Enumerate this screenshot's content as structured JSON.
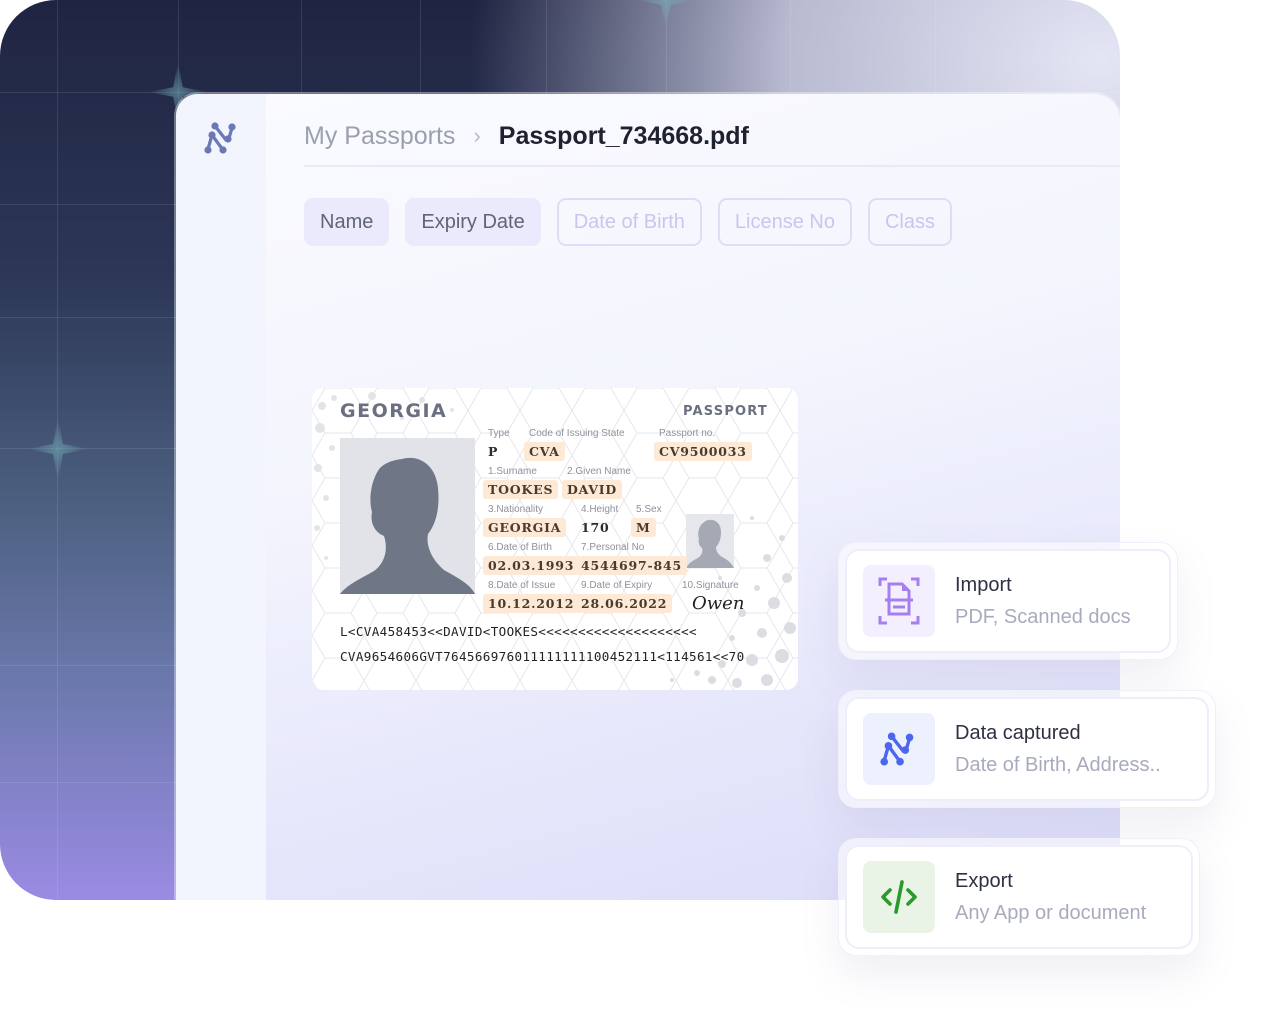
{
  "breadcrumb": {
    "parent": "My Passports",
    "separator": "›",
    "current": "Passport_734668.pdf"
  },
  "filter_chips": [
    {
      "label": "Name",
      "state": "active"
    },
    {
      "label": "Expiry Date",
      "state": "active"
    },
    {
      "label": "Date of Birth",
      "state": "inactive"
    },
    {
      "label": "License No",
      "state": "inactive"
    },
    {
      "label": "Class",
      "state": "inactive"
    }
  ],
  "passport": {
    "country": "GEORGIA",
    "document_type": "PASSPORT",
    "fields": {
      "type": {
        "label": "Type",
        "value": "P"
      },
      "issuing_state": {
        "label": "Code of Issuing State",
        "value": "CVA"
      },
      "passport_no": {
        "label": "Passport no.",
        "value": "CV9500033"
      },
      "surname": {
        "label": "1.Surname",
        "value": "TOOKES"
      },
      "given_name": {
        "label": "2.Given Name",
        "value": "DAVID"
      },
      "nationality": {
        "label": "3.Nationality",
        "value": "GEORGIA"
      },
      "height": {
        "label": "4.Height",
        "value": "170"
      },
      "sex": {
        "label": "5.Sex",
        "value": "M"
      },
      "date_of_birth": {
        "label": "6.Date of Birth",
        "value": "02.03.1993"
      },
      "personal_no": {
        "label": "7.Personal No",
        "value": "4544697-845"
      },
      "date_of_issue": {
        "label": "8.Date of Issue",
        "value": "10.12.2012"
      },
      "date_of_expiry": {
        "label": "9.Date of Expiry",
        "value": "28.06.2022"
      },
      "signature": {
        "label": "10.Signature",
        "value": "Owen"
      }
    },
    "mrz": [
      "L<CVA458453<<DAVID<TOOKES<<<<<<<<<<<<<<<<<<<<",
      "CVA9654606GVT764566976011111111100452111<114561<<70"
    ]
  },
  "feature_cards": [
    {
      "title": "Import",
      "subtitle": "PDF, Scanned docs",
      "icon": "document-scan-icon",
      "icon_bg": "#f3effe",
      "icon_color": "#a57ff0"
    },
    {
      "title": "Data captured",
      "subtitle": "Date of Birth, Address..",
      "icon": "nodes-logo-icon",
      "icon_bg": "#edf1fd",
      "icon_color": "#4d66f0"
    },
    {
      "title": "Export",
      "subtitle": "Any App or document",
      "icon": "code-icon",
      "icon_bg": "#e9f4e6",
      "icon_color": "#2a9a2a"
    }
  ],
  "colors": {
    "logo": "#6b78b5",
    "highlight": "#fde9d6",
    "chip_active_bg": "#ebeafc",
    "chip_inactive_border": "#dedcf7"
  }
}
